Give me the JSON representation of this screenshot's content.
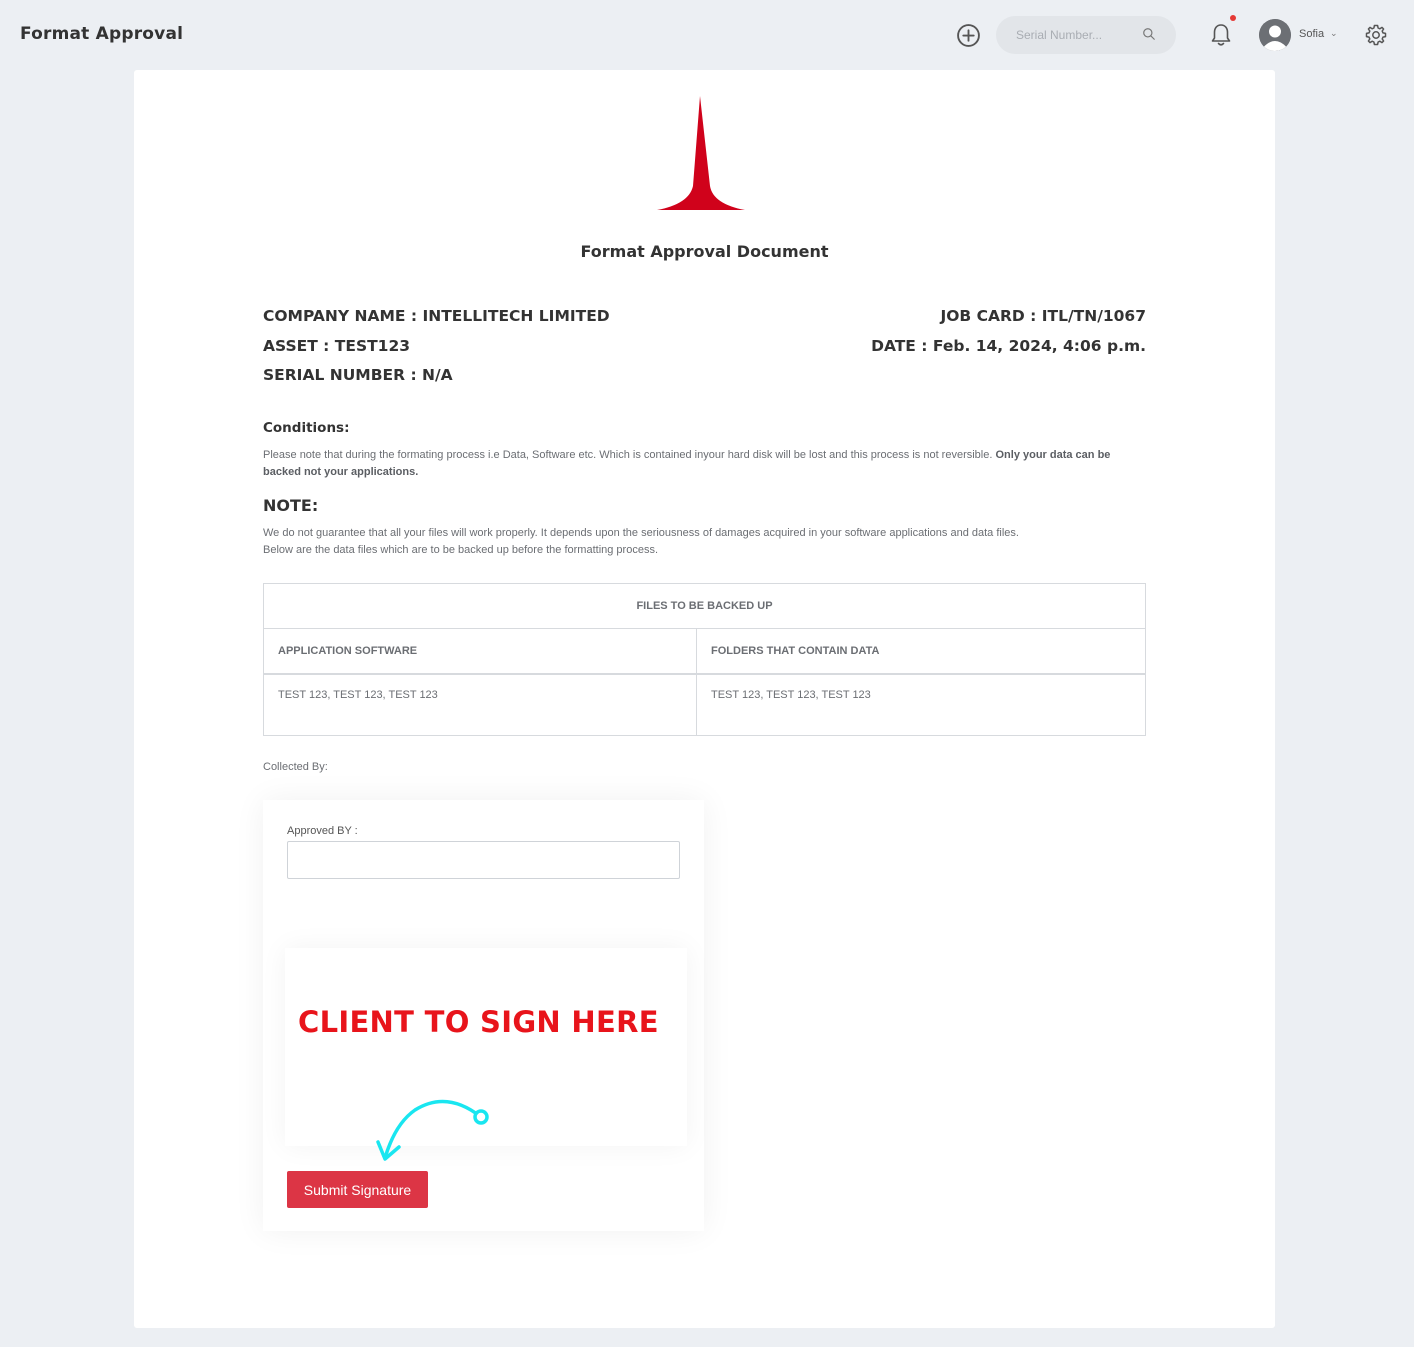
{
  "header": {
    "title": "Format Approval",
    "search_placeholder": "Serial Number...",
    "user_name": "Sofia"
  },
  "document": {
    "title": "Format Approval Document",
    "company_name": "COMPANY NAME : INTELLITECH LIMITED",
    "asset": "ASSET : TEST123",
    "serial_number": "SERIAL NUMBER : N/A",
    "job_card": "JOB CARD : ITL/TN/1067",
    "date": "DATE : Feb. 14, 2024, 4:06 p.m.",
    "conditions_heading": "Conditions:",
    "conditions_text": "Please note that during the formating process i.e Data, Software etc. Which is contained inyour hard disk will be lost and this process is not reversible.",
    "conditions_bold": "Only your data can be backed not your applications.",
    "note_heading": "NOTE:",
    "note_line1": "We do not guarantee that all your files will work properly. It depends upon the seriousness of damages acquired in your software applications and data files.",
    "note_line2": "Below are the data files which are to be backed up before the formatting process.",
    "table": {
      "title": "FILES TO BE BACKED UP",
      "col1_header": "APPLICATION SOFTWARE",
      "col2_header": "FOLDERS THAT CONTAIN DATA",
      "col1_value": "TEST 123, TEST 123, TEST 123",
      "col2_value": "TEST 123, TEST 123, TEST 123"
    },
    "collected_by": "Collected By:",
    "approved_by_label": "Approved BY :",
    "approved_by_value": "",
    "sign_here": "CLIENT TO SIGN HERE",
    "submit_label": "Submit Signature"
  },
  "colors": {
    "brand_red": "#d0021b",
    "submit_red": "#dc3545",
    "annotation_red": "#e8141b",
    "annotation_arrow": "#19e6f0"
  },
  "icons": [
    "add-circle-icon",
    "search-icon",
    "bell-icon",
    "avatar-icon",
    "chevron-down-icon",
    "gear-icon",
    "logo-icon",
    "curved-arrow-icon"
  ]
}
